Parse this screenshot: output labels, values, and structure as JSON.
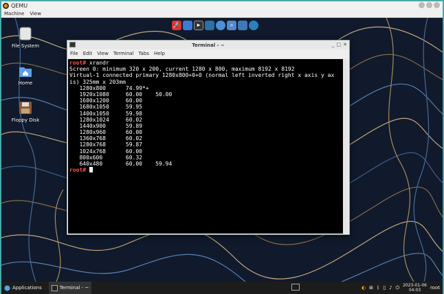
{
  "host": {
    "title": "QEMU",
    "menu": [
      "Machine",
      "View"
    ]
  },
  "desktop_icons": [
    {
      "label": "File System",
      "icon": "drive-icon"
    },
    {
      "label": "Home",
      "icon": "home-folder-icon"
    },
    {
      "label": "Floppy Disk",
      "icon": "floppy-icon"
    }
  ],
  "dock": [
    "rocket-icon",
    "desktop-icon",
    "terminal-icon",
    "file-manager-icon",
    "web-browser-icon",
    "search-icon",
    "folder-icon",
    "network-icon"
  ],
  "terminal": {
    "title": "Terminal - ~",
    "menu": [
      "File",
      "Edit",
      "View",
      "Terminal",
      "Tabs",
      "Help"
    ],
    "prompt": "root#",
    "command": " xrandr",
    "output": [
      "Screen 0: minimum 320 x 200, current 1280 x 800, maximum 8192 x 8192",
      "Virtual-1 connected primary 1280x800+0+0 (normal left inverted right x axis y ax",
      "is) 325mm x 203mm",
      "   1280x800      74.99*+",
      "   1920x1080     60.00    50.00",
      "   1600x1200     60.00",
      "   1680x1050     59.95",
      "   1400x1050     59.98",
      "   1280x1024     60.02",
      "   1440x900      59.89",
      "   1280x960      60.00",
      "   1360x768      60.02",
      "   1280x768      59.87",
      "   1024x768      60.00",
      "   800x600       60.32",
      "   640x480       60.00    59.94"
    ]
  },
  "taskbar": {
    "apps_label": "Applications",
    "task_label": "Terminal - ~",
    "date": "2023-01-06",
    "time": "04:03",
    "user": "root"
  },
  "colors": {
    "prompt": "#ff5555",
    "wallpaper": "#0f1a2e",
    "frame": "#4aa9a9"
  }
}
